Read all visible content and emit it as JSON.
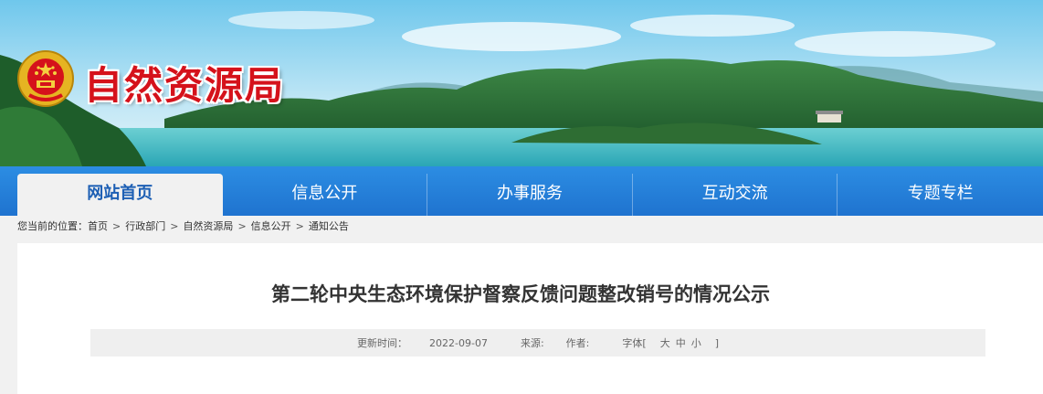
{
  "header": {
    "site_name": "自然资源局"
  },
  "nav": {
    "items": [
      {
        "label": "网站首页",
        "active": true
      },
      {
        "label": "信息公开",
        "active": false
      },
      {
        "label": "办事服务",
        "active": false
      },
      {
        "label": "互动交流",
        "active": false
      },
      {
        "label": "专题专栏",
        "active": false
      }
    ]
  },
  "breadcrumb": {
    "prefix": "您当前的位置：",
    "items": [
      "首页",
      "行政部门",
      "自然资源局",
      "信息公开",
      "通知公告"
    ],
    "separator": ">"
  },
  "article": {
    "title": "第二轮中央生态环境保护督察反馈问题整改销号的情况公示",
    "updated_label": "更新时间：",
    "updated_value": "2022-09-07",
    "source_label": "来源:",
    "author_label": "作者:",
    "font_label": "字体[",
    "font_large": "大",
    "font_medium": "中",
    "font_small": "小",
    "font_close": "]"
  },
  "colors": {
    "brand_red": "#d5121b",
    "nav_blue": "#2281d9",
    "active_text": "#1d5fb4"
  },
  "icons": {
    "emblem": "national-emblem-icon"
  }
}
